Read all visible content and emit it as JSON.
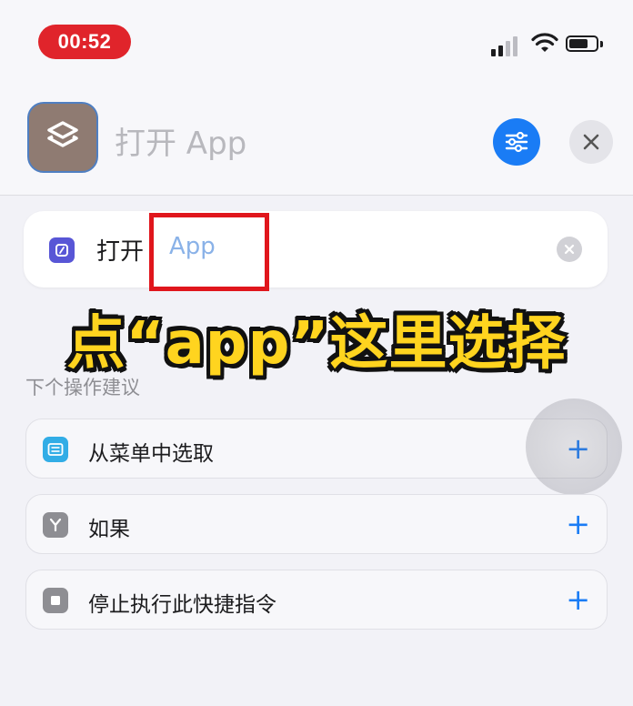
{
  "status_bar": {
    "time": "00:52",
    "recording_color": "#e0242b",
    "icons": [
      "signal-icon",
      "wifi-icon",
      "battery-icon"
    ]
  },
  "header": {
    "title": "打开 App",
    "app_icon": "shortcuts-layers-icon",
    "settings_icon": "sliders-icon",
    "close_icon": "close-icon",
    "accent_color": "#1a7cf5"
  },
  "action": {
    "verb": "打开",
    "parameter": "App",
    "icon": "app-icon",
    "clear_icon": "clear-icon"
  },
  "overlay": {
    "caption": "点“app”这里选择",
    "color": "#ffd41f"
  },
  "suggestions": {
    "label": "下个操作建议",
    "items": [
      {
        "label": "从菜单中选取",
        "icon": "menu-list-icon",
        "add": "+"
      },
      {
        "label": "如果",
        "icon": "if-branch-icon",
        "add": "+"
      },
      {
        "label": "停止执行此快捷指令",
        "icon": "stop-icon",
        "add": "+"
      }
    ]
  }
}
